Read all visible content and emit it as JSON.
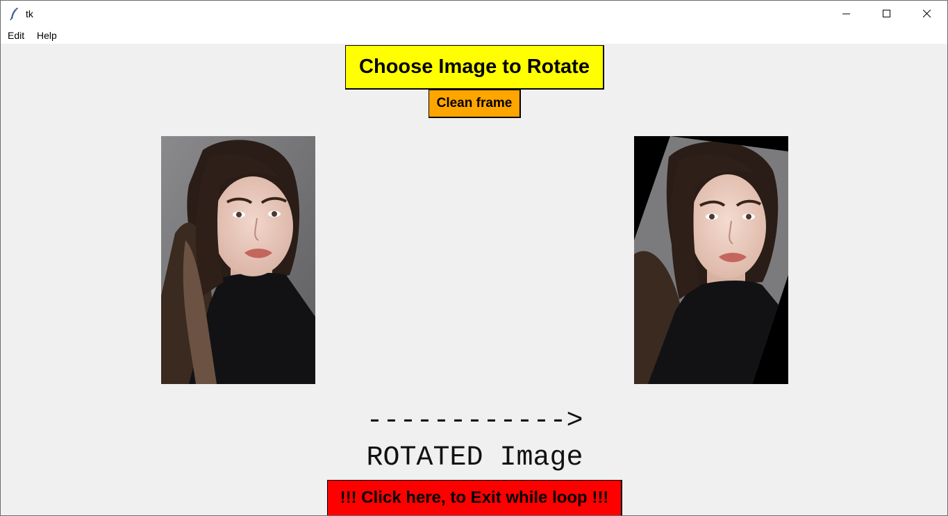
{
  "window": {
    "title": "tk",
    "controls": [
      "minimize",
      "maximize",
      "close"
    ]
  },
  "menu": {
    "items": [
      "Edit",
      "Help"
    ]
  },
  "buttons": {
    "choose_label": "Choose Image to Rotate",
    "choose_color": "#ffff00",
    "clean_label": "Clean frame",
    "clean_color": "#ffa500",
    "exit_label": "!!! Click here, to Exit while loop !!!",
    "exit_color": "#ff0000"
  },
  "images": {
    "original": {
      "rotated": false
    },
    "result": {
      "rotated": true
    }
  },
  "labels": {
    "arrow": "------------>",
    "rotated": "ROTATED Image"
  }
}
